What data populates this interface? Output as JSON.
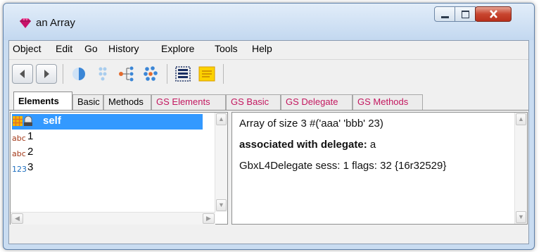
{
  "window": {
    "title": "an Array"
  },
  "menu": [
    "Object",
    "Edit",
    "Go",
    "History",
    "Explore",
    "Tools",
    "Help"
  ],
  "toolbar": {
    "icons": [
      "back-arrow",
      "forward-arrow",
      "half-sphere",
      "tree-collapsed",
      "tree-expand",
      "cluster",
      "list-select",
      "sticky-note"
    ]
  },
  "tabs": [
    {
      "label": "Elements",
      "active": true
    },
    {
      "label": "Basic",
      "active": false
    },
    {
      "label": "Methods",
      "active": false
    },
    {
      "label": "GS Elements",
      "active": false
    },
    {
      "label": "GS Basic",
      "active": false
    },
    {
      "label": "GS Delegate",
      "active": false
    },
    {
      "label": "GS Methods",
      "active": false
    }
  ],
  "elements": [
    {
      "type": "",
      "label": "self",
      "selected": true
    },
    {
      "type": "abc",
      "label": "1",
      "selected": false
    },
    {
      "type": "abc",
      "label": "2",
      "selected": false
    },
    {
      "type": "123",
      "label": "3",
      "selected": false
    }
  ],
  "detail": {
    "line1": "Array of size 3 #('aaa' 'bbb' 23)",
    "line2_bold": "associated with delegate:",
    "line2_rest": " a",
    "line3": "GbxL4Delegate sess: 1 flags: 32 {16r32529}"
  },
  "colors": {
    "gs_tab_text": "#c3175f",
    "selection": "#3399ff",
    "string_type": "#a33a1a",
    "number_type": "#1f6fbf"
  }
}
